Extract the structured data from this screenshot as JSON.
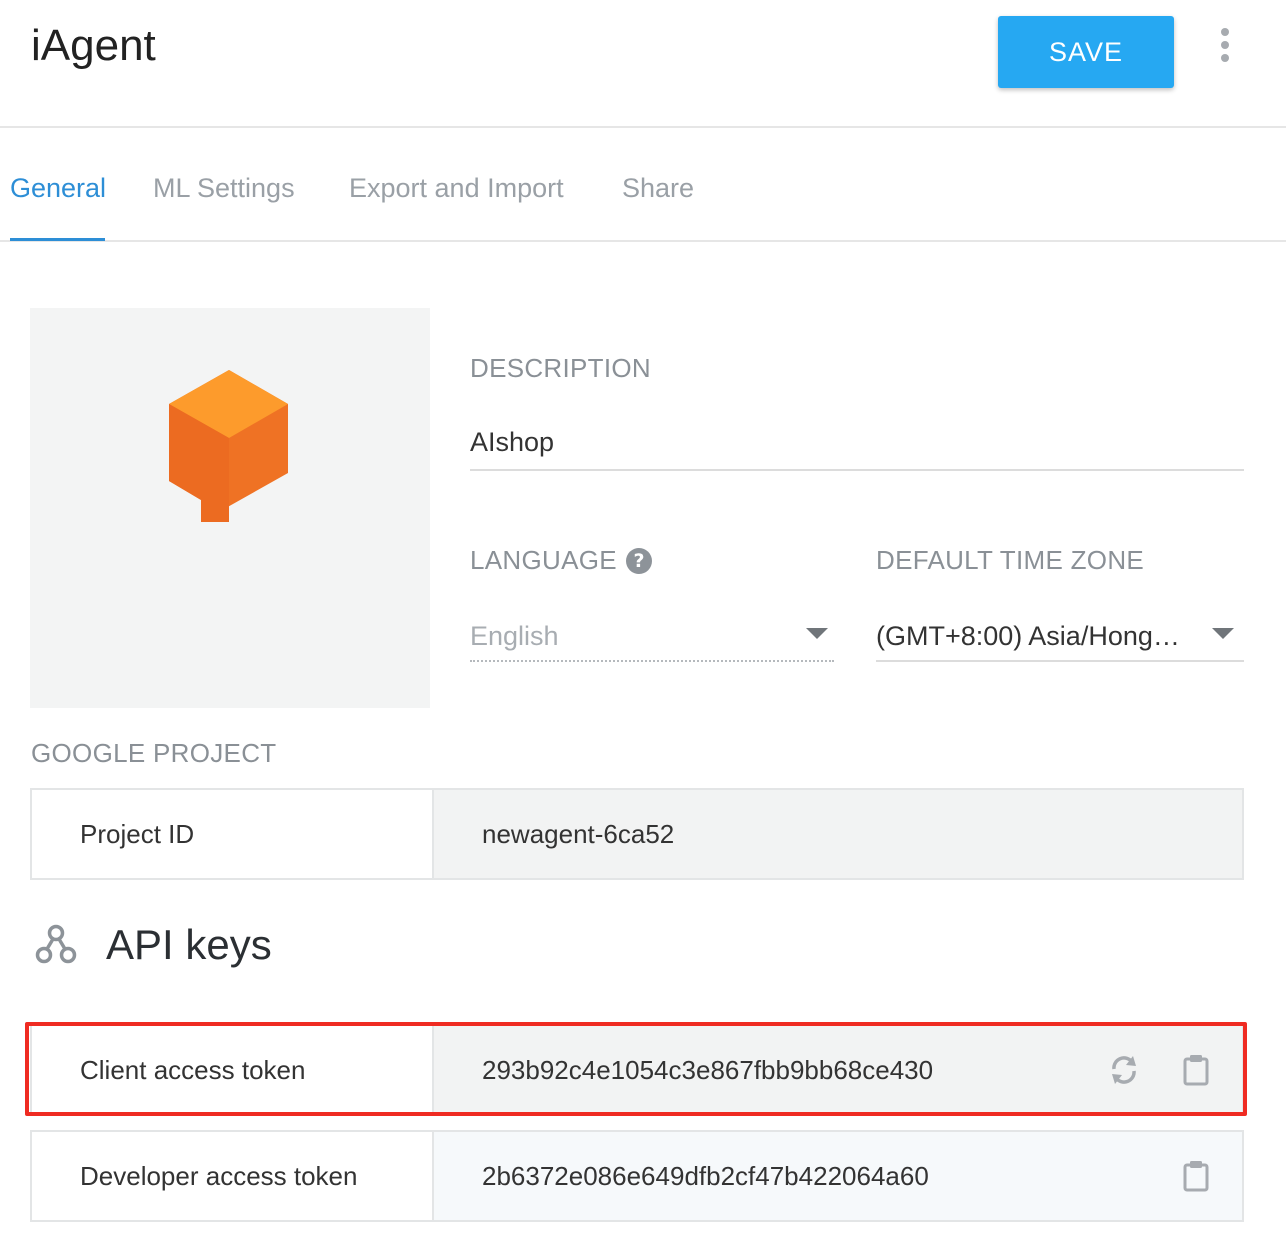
{
  "app": {
    "title": "iAgent"
  },
  "toolbar": {
    "save_label": "SAVE",
    "more_icon": "more-vert-icon"
  },
  "tabs": [
    {
      "label": "General",
      "active": true
    },
    {
      "label": "ML Settings",
      "active": false
    },
    {
      "label": "Export and Import",
      "active": false
    },
    {
      "label": "Share",
      "active": false
    }
  ],
  "general": {
    "avatar_icon": "agent-cube-logo",
    "description": {
      "label": "DESCRIPTION",
      "value": "AIshop"
    },
    "language": {
      "label": "LANGUAGE",
      "value": "English",
      "help_icon": "help-icon"
    },
    "timezone": {
      "label": "DEFAULT TIME ZONE",
      "value": "(GMT+8:00) Asia/Hong…"
    }
  },
  "google_project": {
    "label": "GOOGLE PROJECT",
    "project_id_label": "Project ID",
    "project_id_value": "newagent-6ca52"
  },
  "api_keys": {
    "title": "API keys",
    "icon": "api-keys-icon",
    "client_token_label": "Client access token",
    "client_token_value": "293b92c4e1054c3e867fbb9bb68ce430",
    "developer_token_label": "Developer access token",
    "developer_token_value": "2b6372e086e649dfb2cf47b422064a60"
  },
  "colors": {
    "accent": "#2d8ed6",
    "save_button": "#26a8f2",
    "highlight_box": "#ef2b22",
    "logo_orange": "#ef7224"
  }
}
